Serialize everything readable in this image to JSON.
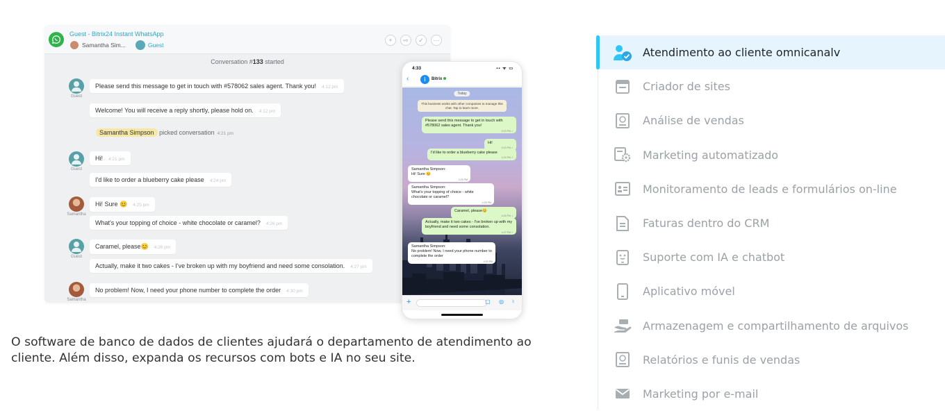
{
  "chat": {
    "title": "Guest - Bitrix24 Instant WhatsApp",
    "participant_name": "Samantha Sim...",
    "guest_label": "Guest",
    "conversation_prefix": "Conversation #",
    "conversation_number": "133",
    "conversation_suffix": " started",
    "header_actions": [
      "+",
      "⇨",
      "✓",
      "···"
    ],
    "messages": [
      {
        "sender": "Guest",
        "text": "Please send this message to get in touch with #578062 sales agent. Thank you!",
        "time": "4:12 pm"
      },
      {
        "sender": "",
        "text": "Welcome! You will receive a reply shortly, please hold on.",
        "time": "4:12 pm"
      },
      {
        "sender": "",
        "system_name": "Samantha Simpson",
        "text": "picked conversation",
        "time": "4:21 pm"
      },
      {
        "sender": "Guest",
        "text": "Hi!",
        "time": "4:21 pm"
      },
      {
        "sender": "",
        "text": "I'd like to order a blueberry cake please",
        "time": "4:24 pm"
      },
      {
        "sender": "Samantha",
        "text": "Hi! Sure 😊",
        "time": "4:25 pm"
      },
      {
        "sender": "",
        "text": "What's your topping of choice - white chocolate or caramel?",
        "time": "4:26 pm"
      },
      {
        "sender": "Guest",
        "text": "Caramel, please😊",
        "time": "4:26 pm"
      },
      {
        "sender": "",
        "text": "Actually, make it two cakes - I've broken up with my boyfriend and need some consolation.",
        "time": "4:27 pm"
      },
      {
        "sender": "Samantha",
        "text": "No problem! Now, I need your phone number to complete the order",
        "time": "4:30 pm"
      }
    ]
  },
  "phone": {
    "time": "4:33",
    "status_icons": "▪▪ ᯤ ▭",
    "back": "‹",
    "contact_icon": "i",
    "contact_name": "Bitrix",
    "date_chip": "Today",
    "notice": "This business works with other companies to manage this chat. Tap to learn more.",
    "bubbles": [
      {
        "dir": "out",
        "text": "Please send this message to get in touch with #578062 sales agent. Thank you!",
        "time": "4:23 PM ✓"
      },
      {
        "dir": "out",
        "text": "Hi!",
        "time": "4:23 PM ✓"
      },
      {
        "dir": "out",
        "text": "I'd like to order a blueberry cake please",
        "time": "4:24 PM ✓"
      },
      {
        "dir": "in",
        "text": "Samantha Simpson:\nHi! Sure 😊",
        "time": "4:25 PM"
      },
      {
        "dir": "in",
        "text": "Samantha Simpson:\nWhat's your topping of choice - white chocolate or caramel?",
        "time": "4:26 PM"
      },
      {
        "dir": "out",
        "text": "Caramel, please😊",
        "time": "4:26 PM ✓"
      },
      {
        "dir": "out",
        "text": "Actually, make it two cakes - I've broken up with my boyfriend and need some consolation.",
        "time": "4:27 PM ✓"
      },
      {
        "dir": "in",
        "text": "Samantha Simpson:\nNo problem! Now, I need your phone number to complete the order",
        "time": "4:30 PM"
      }
    ],
    "input_plus": "+",
    "input_tools": "▢ ◎ ♮"
  },
  "description": "O software de banco de dados de clientes ajudará o departamento de atendimento ao cliente. Além disso, expanda os recursos com bots e IA no seu site.",
  "features": [
    {
      "label": "Atendimento ao cliente omnicanalv",
      "icon": "user-check-icon",
      "active": true
    },
    {
      "label": "Criador de sites",
      "icon": "window-icon",
      "active": false
    },
    {
      "label": "Análise de vendas",
      "icon": "sales-analytics-icon",
      "active": false
    },
    {
      "label": "Marketing automatizado",
      "icon": "automation-gear-icon",
      "active": false
    },
    {
      "label": "Monitoramento de leads e formulários on-line",
      "icon": "form-icon",
      "active": false
    },
    {
      "label": "Faturas dentro do CRM",
      "icon": "invoice-icon",
      "active": false
    },
    {
      "label": "Suporte com IA e chatbot",
      "icon": "chatbot-icon",
      "active": false
    },
    {
      "label": "Aplicativo móvel",
      "icon": "mobile-icon",
      "active": false
    },
    {
      "label": "Armazenagem e compartilhamento de arquivos",
      "icon": "storage-hand-icon",
      "active": false
    },
    {
      "label": "Relatórios e funis de vendas",
      "icon": "report-icon",
      "active": false
    },
    {
      "label": "Marketing por e-mail",
      "icon": "envelope-icon",
      "active": false
    }
  ],
  "colors": {
    "accent": "#2fc6f6",
    "active_bg": "#e6f5fd",
    "whatsapp": "#2fb34a",
    "muted_text": "#9ba1a7"
  }
}
